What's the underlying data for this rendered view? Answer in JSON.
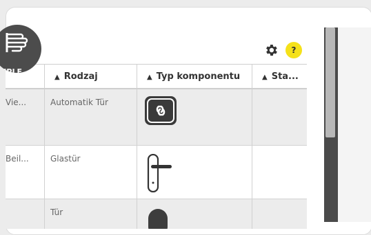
{
  "badge": {
    "label": "MPLE"
  },
  "toolbar": {
    "settings_icon": "gear-icon",
    "help_label": "?"
  },
  "colors": {
    "help_bg": "#f5e11a",
    "header_border": "#cfcfcf",
    "row_alt": "#ececec"
  },
  "table": {
    "columns": [
      {
        "label": "Rodzaj"
      },
      {
        "label": "Typ komponentu"
      },
      {
        "label": "Sta..."
      }
    ],
    "rows": [
      {
        "c0": "Vie...",
        "rodzaj": "Automatik Tür",
        "icon": "link-icon"
      },
      {
        "c0": "Beil...",
        "rodzaj": "Glastür",
        "icon": "door-handle-icon"
      },
      {
        "c0": "",
        "rodzaj": "Tür",
        "icon": "door-handle-icon"
      }
    ]
  }
}
